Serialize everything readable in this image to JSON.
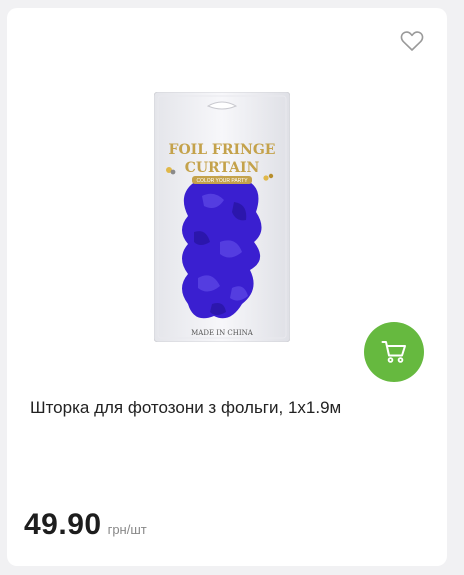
{
  "product": {
    "title": "Шторка для фотозони з фольги, 1х1.9м",
    "price": "49.90",
    "unit": "грн/шт",
    "image_alt": "Foil fringe curtain package",
    "package_text": {
      "brand_line1": "FOIL FRINGE",
      "brand_line2": "CURTAIN",
      "tagline": "COLOR YOUR PARTY",
      "origin": "MADE IN CHINA"
    },
    "foil_color": "#3a1fd0"
  },
  "icons": {
    "favorite": "heart-outline-icon",
    "cart": "shopping-cart-icon"
  },
  "colors": {
    "accent": "#66b93f",
    "price_text": "#1d1d1d"
  }
}
